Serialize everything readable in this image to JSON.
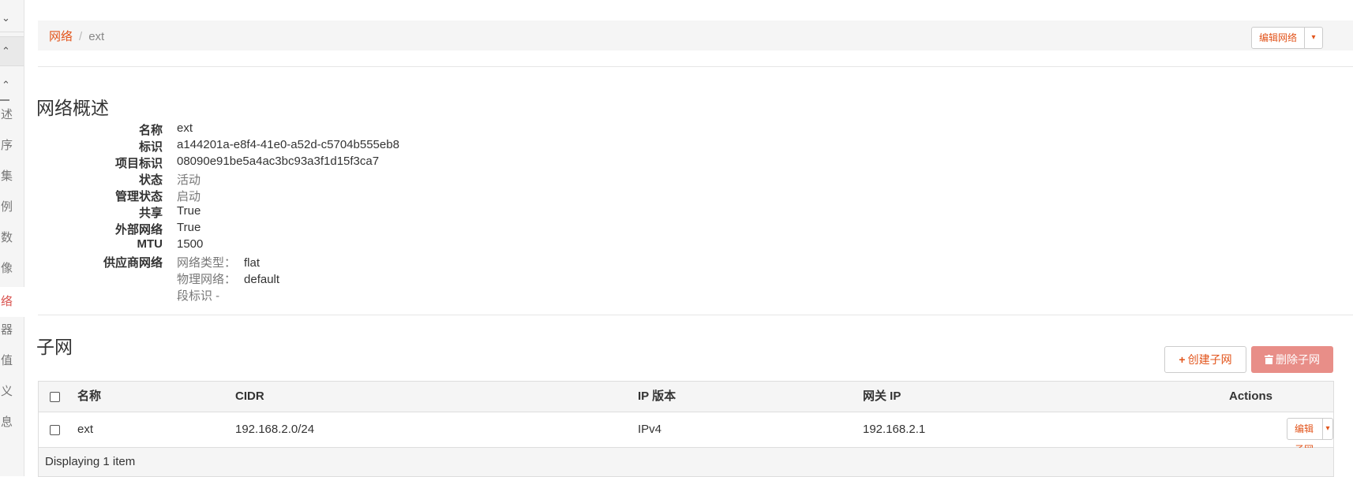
{
  "sidebar": {
    "chevrons": [
      "⌄",
      "⌃",
      "⌃"
    ],
    "items": [
      {
        "label": "述",
        "active": false
      },
      {
        "label": "序",
        "active": false
      },
      {
        "label": "集",
        "active": false
      },
      {
        "label": "例",
        "active": false
      },
      {
        "label": "数",
        "active": false
      },
      {
        "label": "像",
        "active": false
      },
      {
        "label": "络",
        "active": true
      },
      {
        "label": "器",
        "active": false
      },
      {
        "label": "值",
        "active": false
      },
      {
        "label": "义",
        "active": false
      },
      {
        "label": "息",
        "active": false
      }
    ]
  },
  "breadcrumb": {
    "parent": "网络",
    "separator": "/",
    "current": "ext"
  },
  "header_actions": {
    "edit_label": "编辑网络",
    "caret": "▾"
  },
  "overview": {
    "title": "网络概述",
    "fields": [
      {
        "label": "名称",
        "value": "ext"
      },
      {
        "label": "标识",
        "value": "a144201a-e8f4-41e0-a52d-c5704b555eb8"
      },
      {
        "label": "项目标识",
        "value": "08090e91be5a4ac3bc93a3f1d15f3ca7"
      },
      {
        "label": "状态",
        "value": "活动"
      },
      {
        "label": "管理状态",
        "value": "启动"
      },
      {
        "label": "共享",
        "value": "True"
      },
      {
        "label": "外部网络",
        "value": "True"
      },
      {
        "label": "MTU",
        "value": "1500"
      }
    ],
    "provider": {
      "label": "供应商网络",
      "network_type_label": "网络类型：",
      "network_type_value": "flat",
      "physical_label": "物理网络：",
      "physical_value": "default",
      "segment_label": "段标识 -"
    }
  },
  "subnets": {
    "title": "子网",
    "create_label": "创建子网",
    "create_icon": "+",
    "delete_label": "删除子网",
    "delete_icon": "trash-icon",
    "columns": [
      "名称",
      "CIDR",
      "IP 版本",
      "网关 IP",
      "Actions"
    ],
    "rows": [
      {
        "name": "ext",
        "cidr": "192.168.2.0/24",
        "ip_version": "IPv4",
        "gateway": "192.168.2.1",
        "action_label": "编辑子网"
      }
    ],
    "footer": "Displaying 1 item"
  },
  "colors": {
    "accent": "#e2541b",
    "danger_disabled": "#e88e88"
  }
}
